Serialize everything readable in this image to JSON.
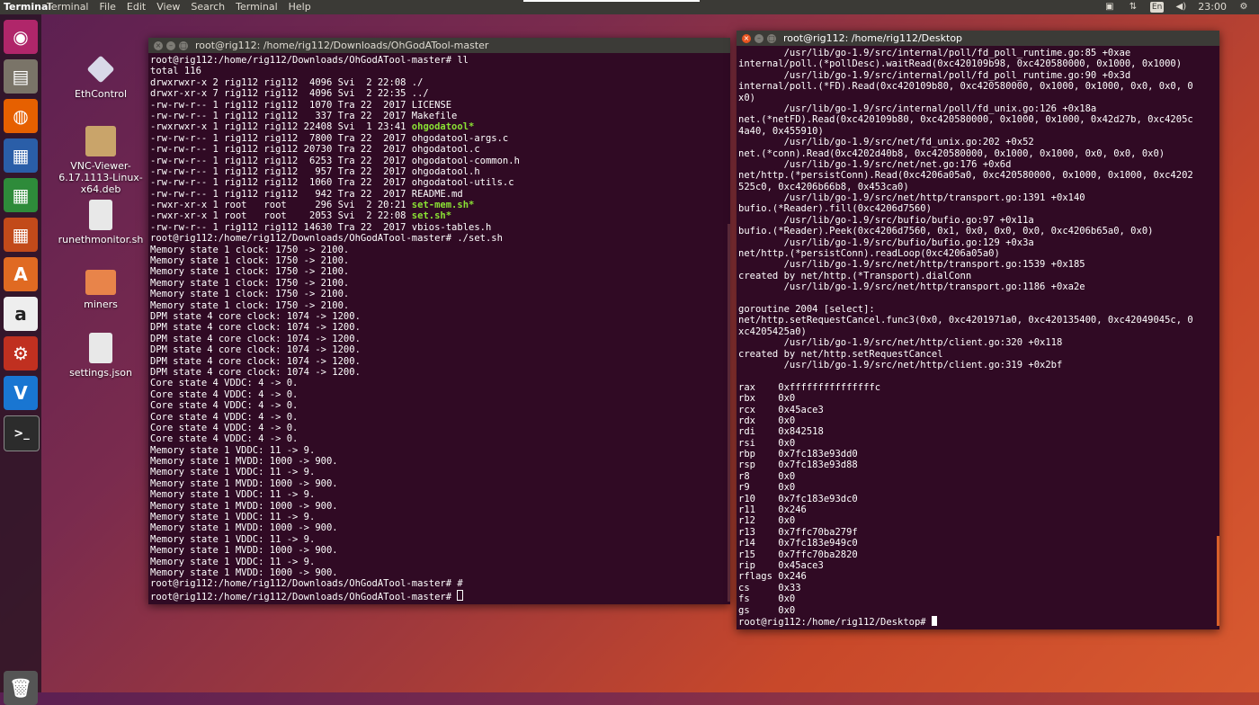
{
  "topbar": {
    "app_name": "Terminal",
    "menus": [
      "Terminal",
      "File",
      "Edit",
      "View",
      "Search",
      "Terminal",
      "Help"
    ],
    "indicators": {
      "lang": "En",
      "time": "23:00"
    }
  },
  "launcher": [
    {
      "name": "ubuntu-dash-icon",
      "glyph": "◉",
      "color": "#b0266a"
    },
    {
      "name": "files-icon",
      "glyph": "▤",
      "color": "#7a7468"
    },
    {
      "name": "firefox-icon",
      "glyph": "◍",
      "color": "#e66000"
    },
    {
      "name": "writer-icon",
      "glyph": "▦",
      "color": "#2a5ea8"
    },
    {
      "name": "calc-icon",
      "glyph": "▦",
      "color": "#2e8b3a"
    },
    {
      "name": "impress-icon",
      "glyph": "▦",
      "color": "#c24a1a"
    },
    {
      "name": "software-center-icon",
      "glyph": "A",
      "color": "#e06a22"
    },
    {
      "name": "amazon-icon",
      "glyph": "a",
      "color": "#eeeeee"
    },
    {
      "name": "settings-icon",
      "glyph": "⚙",
      "color": "#c03020"
    },
    {
      "name": "vnc-icon",
      "glyph": "V",
      "color": "#1976d2"
    },
    {
      "name": "terminal-icon",
      "glyph": ">_",
      "color": "#2c2c2c"
    },
    {
      "name": "trash-icon",
      "glyph": "🗑",
      "color": "#555555"
    }
  ],
  "desktop_icons": [
    {
      "name": "ethcontrol-icon",
      "label": "EthControl",
      "color": "#d8d8e8"
    },
    {
      "name": "vnc-deb-icon",
      "label": "VNC-Viewer-6.17.1113-Linux-x64.deb",
      "color": "#c9a46a"
    },
    {
      "name": "runethmonitor-icon",
      "label": "runethmonitor.sh",
      "color": "#e8e8e8"
    },
    {
      "name": "miners-folder-icon",
      "label": "miners",
      "color": "#e8844a"
    },
    {
      "name": "settings-json-icon",
      "label": "settings.json",
      "color": "#e8e8e8"
    }
  ],
  "term_left": {
    "title": "root@rig112: /home/rig112/Downloads/OhGodATool-master",
    "lines": [
      [
        "root@rig112:/home/rig112/Downloads/OhGodATool-master# ll",
        ""
      ],
      [
        "total 116",
        ""
      ],
      [
        "drwxrwxr-x 2 rig112 rig112  4096 Svi  2 22:08 ./",
        ""
      ],
      [
        "drwxr-xr-x 7 rig112 rig112  4096 Svi  2 22:35 ../",
        ""
      ],
      [
        "-rw-rw-r-- 1 rig112 rig112  1070 Tra 22  2017 LICENSE",
        ""
      ],
      [
        "-rw-rw-r-- 1 rig112 rig112   337 Tra 22  2017 Makefile",
        ""
      ],
      [
        "-rwxrwxr-x 1 rig112 rig112 22408 Svi  1 23:41 ",
        "ohgodatool*"
      ],
      [
        "-rw-rw-r-- 1 rig112 rig112  7800 Tra 22  2017 ohgodatool-args.c",
        ""
      ],
      [
        "-rw-rw-r-- 1 rig112 rig112 20730 Tra 22  2017 ohgodatool.c",
        ""
      ],
      [
        "-rw-rw-r-- 1 rig112 rig112  6253 Tra 22  2017 ohgodatool-common.h",
        ""
      ],
      [
        "-rw-rw-r-- 1 rig112 rig112   957 Tra 22  2017 ohgodatool.h",
        ""
      ],
      [
        "-rw-rw-r-- 1 rig112 rig112  1060 Tra 22  2017 ohgodatool-utils.c",
        ""
      ],
      [
        "-rw-rw-r-- 1 rig112 rig112   942 Tra 22  2017 README.md",
        ""
      ],
      [
        "-rwxr-xr-x 1 root   root     296 Svi  2 20:21 ",
        "set-mem.sh*"
      ],
      [
        "-rwxr-xr-x 1 root   root    2053 Svi  2 22:08 ",
        "set.sh*"
      ],
      [
        "-rw-rw-r-- 1 rig112 rig112 14630 Tra 22  2017 vbios-tables.h",
        ""
      ],
      [
        "root@rig112:/home/rig112/Downloads/OhGodATool-master# ./set.sh",
        ""
      ],
      [
        "Memory state 1 clock: 1750 -> 2100.",
        ""
      ],
      [
        "Memory state 1 clock: 1750 -> 2100.",
        ""
      ],
      [
        "Memory state 1 clock: 1750 -> 2100.",
        ""
      ],
      [
        "Memory state 1 clock: 1750 -> 2100.",
        ""
      ],
      [
        "Memory state 1 clock: 1750 -> 2100.",
        ""
      ],
      [
        "Memory state 1 clock: 1750 -> 2100.",
        ""
      ],
      [
        "DPM state 4 core clock: 1074 -> 1200.",
        ""
      ],
      [
        "DPM state 4 core clock: 1074 -> 1200.",
        ""
      ],
      [
        "DPM state 4 core clock: 1074 -> 1200.",
        ""
      ],
      [
        "DPM state 4 core clock: 1074 -> 1200.",
        ""
      ],
      [
        "DPM state 4 core clock: 1074 -> 1200.",
        ""
      ],
      [
        "DPM state 4 core clock: 1074 -> 1200.",
        ""
      ],
      [
        "Core state 4 VDDC: 4 -> 0.",
        ""
      ],
      [
        "Core state 4 VDDC: 4 -> 0.",
        ""
      ],
      [
        "Core state 4 VDDC: 4 -> 0.",
        ""
      ],
      [
        "Core state 4 VDDC: 4 -> 0.",
        ""
      ],
      [
        "Core state 4 VDDC: 4 -> 0.",
        ""
      ],
      [
        "Core state 4 VDDC: 4 -> 0.",
        ""
      ],
      [
        "Memory state 1 VDDC: 11 -> 9.",
        ""
      ],
      [
        "Memory state 1 MVDD: 1000 -> 900.",
        ""
      ],
      [
        "Memory state 1 VDDC: 11 -> 9.",
        ""
      ],
      [
        "Memory state 1 MVDD: 1000 -> 900.",
        ""
      ],
      [
        "Memory state 1 VDDC: 11 -> 9.",
        ""
      ],
      [
        "Memory state 1 MVDD: 1000 -> 900.",
        ""
      ],
      [
        "Memory state 1 VDDC: 11 -> 9.",
        ""
      ],
      [
        "Memory state 1 MVDD: 1000 -> 900.",
        ""
      ],
      [
        "Memory state 1 VDDC: 11 -> 9.",
        ""
      ],
      [
        "Memory state 1 MVDD: 1000 -> 900.",
        ""
      ],
      [
        "Memory state 1 VDDC: 11 -> 9.",
        ""
      ],
      [
        "Memory state 1 MVDD: 1000 -> 900.",
        ""
      ],
      [
        "root@rig112:/home/rig112/Downloads/OhGodATool-master# #",
        ""
      ],
      [
        "root@rig112:/home/rig112/Downloads/OhGodATool-master# ",
        ""
      ]
    ]
  },
  "term_right": {
    "title": "root@rig112: /home/rig112/Desktop",
    "lines": [
      "        /usr/lib/go-1.9/src/internal/poll/fd_poll_runtime.go:85 +0xae",
      "internal/poll.(*pollDesc).waitRead(0xc420109b98, 0xc420580000, 0x1000, 0x1000)",
      "        /usr/lib/go-1.9/src/internal/poll/fd_poll_runtime.go:90 +0x3d",
      "internal/poll.(*FD).Read(0xc420109b80, 0xc420580000, 0x1000, 0x1000, 0x0, 0x0, 0",
      "x0)",
      "        /usr/lib/go-1.9/src/internal/poll/fd_unix.go:126 +0x18a",
      "net.(*netFD).Read(0xc420109b80, 0xc420580000, 0x1000, 0x1000, 0x42d27b, 0xc4205c",
      "4a40, 0x455910)",
      "        /usr/lib/go-1.9/src/net/fd_unix.go:202 +0x52",
      "net.(*conn).Read(0xc4202d40b8, 0xc420580000, 0x1000, 0x1000, 0x0, 0x0, 0x0)",
      "        /usr/lib/go-1.9/src/net/net.go:176 +0x6d",
      "net/http.(*persistConn).Read(0xc4206a05a0, 0xc420580000, 0x1000, 0x1000, 0xc4202",
      "525c0, 0xc4206b66b8, 0x453ca0)",
      "        /usr/lib/go-1.9/src/net/http/transport.go:1391 +0x140",
      "bufio.(*Reader).fill(0xc4206d7560)",
      "        /usr/lib/go-1.9/src/bufio/bufio.go:97 +0x11a",
      "bufio.(*Reader).Peek(0xc4206d7560, 0x1, 0x0, 0x0, 0x0, 0xc4206b65a0, 0x0)",
      "        /usr/lib/go-1.9/src/bufio/bufio.go:129 +0x3a",
      "net/http.(*persistConn).readLoop(0xc4206a05a0)",
      "        /usr/lib/go-1.9/src/net/http/transport.go:1539 +0x185",
      "created by net/http.(*Transport).dialConn",
      "        /usr/lib/go-1.9/src/net/http/transport.go:1186 +0xa2e",
      "",
      "goroutine 2004 [select]:",
      "net/http.setRequestCancel.func3(0x0, 0xc4201971a0, 0xc420135400, 0xc42049045c, 0",
      "xc4205425a0)",
      "        /usr/lib/go-1.9/src/net/http/client.go:320 +0x118",
      "created by net/http.setRequestCancel",
      "        /usr/lib/go-1.9/src/net/http/client.go:319 +0x2bf",
      "",
      "rax    0xfffffffffffffffc",
      "rbx    0x0",
      "rcx    0x45ace3",
      "rdx    0x0",
      "rdi    0x842518",
      "rsi    0x0",
      "rbp    0x7fc183e93dd0",
      "rsp    0x7fc183e93d88",
      "r8     0x0",
      "r9     0x0",
      "r10    0x7fc183e93dc0",
      "r11    0x246",
      "r12    0x0",
      "r13    0x7ffc70ba279f",
      "r14    0x7fc183e949c0",
      "r15    0x7ffc70ba2820",
      "rip    0x45ace3",
      "rflags 0x246",
      "cs     0x33",
      "fs     0x0",
      "gs     0x0",
      "root@rig112:/home/rig112/Desktop# "
    ]
  }
}
